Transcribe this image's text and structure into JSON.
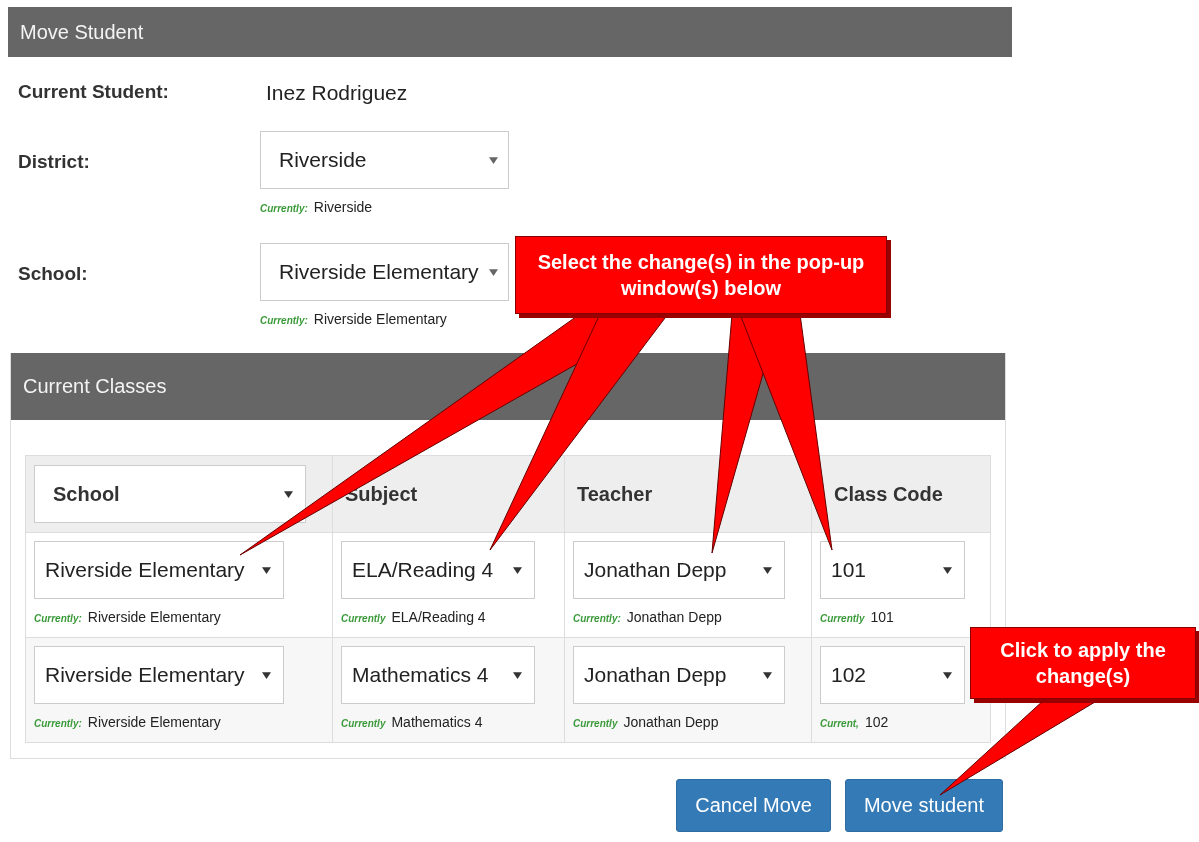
{
  "header": {
    "title": "Move Student"
  },
  "form": [
    {
      "label": "Current Student:",
      "kind": "text",
      "value": "Inez Rodriguez"
    },
    {
      "label": "District:",
      "kind": "select",
      "value": "Riverside",
      "current_label": "Currently:",
      "current": "Riverside"
    },
    {
      "label": "School:",
      "kind": "select",
      "value": "Riverside Elementary",
      "current_label": "Currently:",
      "current": "Riverside Elementary"
    }
  ],
  "classes": {
    "title": "Current Classes",
    "columns": [
      {
        "label": "School",
        "kind": "select"
      },
      {
        "label": "Subject",
        "kind": "text"
      },
      {
        "label": "Teacher",
        "kind": "text"
      },
      {
        "label": "Class Code",
        "kind": "text"
      }
    ],
    "rows": [
      [
        {
          "value": "Riverside Elementary",
          "current_label": "Currently:",
          "current": "Riverside Elementary"
        },
        {
          "value": "ELA/Reading 4",
          "current_label": "Currently",
          "current": "ELA/Reading 4"
        },
        {
          "value": "Jonathan Depp",
          "current_label": "Currently:",
          "current": "Jonathan Depp"
        },
        {
          "value": "101",
          "current_label": "Currently",
          "current": "101"
        }
      ],
      [
        {
          "value": "Riverside Elementary",
          "current_label": "Currently:",
          "current": "Riverside Elementary"
        },
        {
          "value": "Mathematics 4",
          "current_label": "Currently",
          "current": "Mathematics 4"
        },
        {
          "value": "Jonathan Depp",
          "current_label": "Currently",
          "current": "Jonathan Depp"
        },
        {
          "value": "102",
          "current_label": "Current,",
          "current": "102"
        }
      ]
    ]
  },
  "buttons": [
    "Cancel Move",
    "Move student"
  ],
  "callouts": [
    {
      "text": "Select the change(s) in the pop-up window(s) below"
    },
    {
      "text": "Click to apply the change(s)"
    }
  ]
}
